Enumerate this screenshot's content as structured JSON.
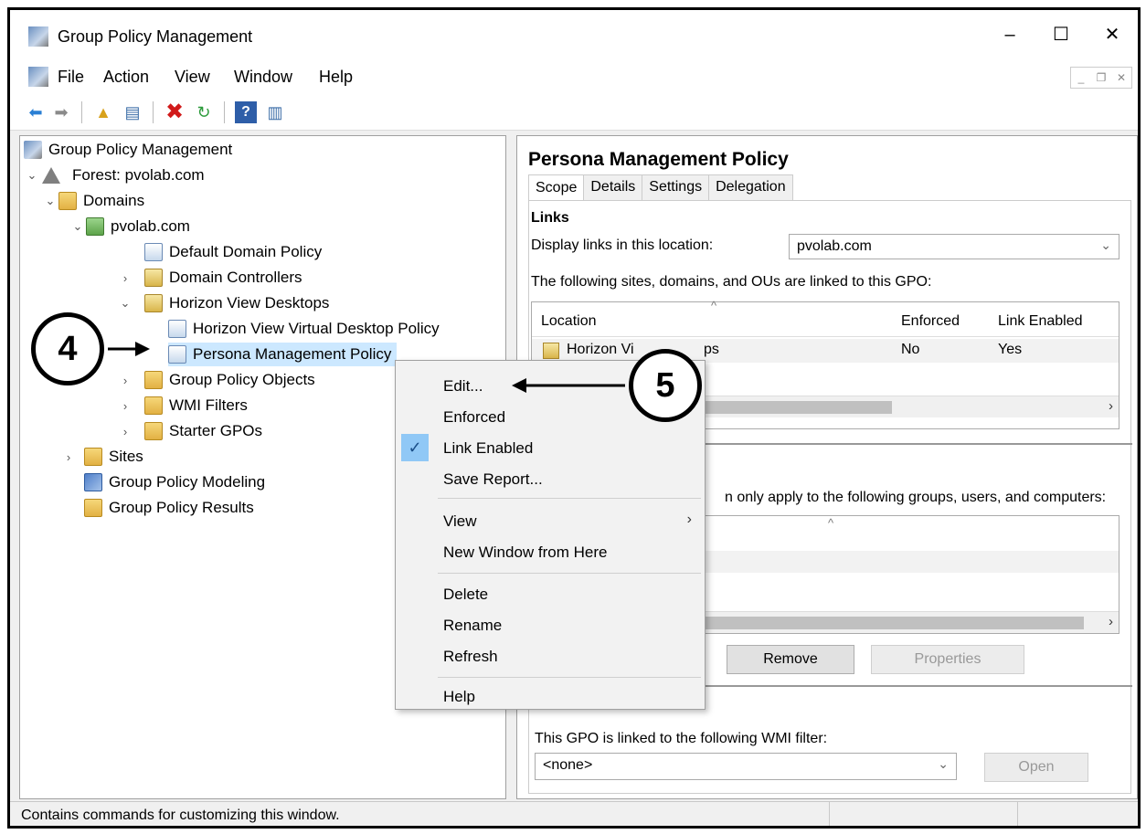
{
  "window": {
    "title": "Group Policy Management",
    "minimize": "–",
    "maximize": "☐",
    "close": "✕"
  },
  "menu": {
    "items": [
      "File",
      "Action",
      "View",
      "Window",
      "Help"
    ]
  },
  "tree": {
    "root": "Group Policy Management",
    "forest": "Forest: pvolab.com",
    "domains": "Domains",
    "domain": "pvolab.com",
    "default_policy": "Default Domain Policy",
    "domain_controllers": "Domain Controllers",
    "horizon_ou": "Horizon View Desktops",
    "horizon_vdp": "Horizon View Virtual Desktop Policy",
    "persona": "Persona Management Policy",
    "gpo_objects": "Group Policy Objects",
    "wmi_filters": "WMI Filters",
    "starter_gpos": "Starter GPOs",
    "sites": "Sites",
    "modeling": "Group Policy Modeling",
    "results": "Group Policy Results"
  },
  "callouts": {
    "step4": "4",
    "step5": "5"
  },
  "details": {
    "title": "Persona Management Policy",
    "tabs": [
      "Scope",
      "Details",
      "Settings",
      "Delegation"
    ],
    "links_heading": "Links",
    "display_links_label": "Display links in this location:",
    "location_value": "pvolab.com",
    "linked_text": "The following sites, domains, and OUs are linked to this GPO:",
    "links_columns": {
      "location": "Location",
      "enforced": "Enforced",
      "link_enabled": "Link Enabled"
    },
    "links_row": {
      "location": "Horizon Vi",
      "location_tail": "ps",
      "enforced": "No",
      "link_enabled": "Yes"
    },
    "filter_text": "n only apply to the following groups, users, and computers:",
    "buttons": {
      "remove": "Remove",
      "properties": "Properties",
      "open": "Open"
    },
    "wmi_label": "This GPO is linked to the following WMI filter:",
    "wmi_value": "<none>"
  },
  "context_menu": {
    "edit": "Edit...",
    "enforced": "Enforced",
    "link_enabled": "Link Enabled",
    "save_report": "Save Report...",
    "view": "View",
    "new_window": "New Window from Here",
    "delete": "Delete",
    "rename": "Rename",
    "refresh": "Refresh",
    "help": "Help"
  },
  "status": {
    "text": "Contains commands for customizing this window."
  }
}
